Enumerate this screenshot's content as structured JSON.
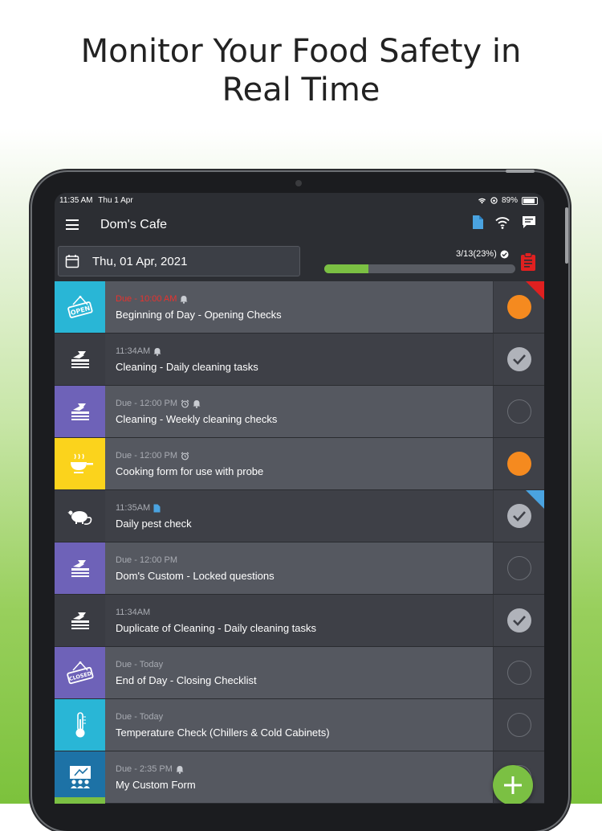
{
  "headline": {
    "line1": "Monitor Your Food Safety in",
    "line2": "Real Time"
  },
  "status_bar": {
    "time": "11:35 AM",
    "date": "Thu 1 Apr",
    "battery": "89%"
  },
  "app_bar": {
    "title": "Dom's Cafe"
  },
  "date_picker": {
    "value": "Thu, 01 Apr, 2021"
  },
  "progress": {
    "label": "3/13(23%)",
    "fraction": 0.23
  },
  "colors": {
    "teal": "#29b6d6",
    "purple": "#6e62b8",
    "yellow": "#fbd31c",
    "dark": "#3a3c43",
    "navy": "#1d72a6",
    "orange": "#f58a1f",
    "green": "#7bc043",
    "overdue_red": "#e8322e"
  },
  "forms": [
    {
      "meta": "Due - 10:00 AM",
      "meta_style": "overdue",
      "meta_icons": [
        "bell-icon"
      ],
      "name": "Beginning of Day - Opening Checks",
      "icon": "open-sign-icon",
      "icon_bg": "#29b6d6",
      "status": "in-progress",
      "corner": "red",
      "alt": false
    },
    {
      "meta": "11:34AM",
      "meta_style": "normal",
      "meta_icons": [
        "bell-icon"
      ],
      "name": "Cleaning - Daily cleaning tasks",
      "icon": "cleaning-icon",
      "icon_bg": "#3a3c43",
      "status": "complete",
      "corner": "",
      "alt": true
    },
    {
      "meta": "Due - 12:00 PM",
      "meta_style": "normal",
      "meta_icons": [
        "alarm-clock-icon",
        "bell-icon"
      ],
      "name": "Cleaning - Weekly cleaning checks",
      "icon": "cleaning-icon",
      "icon_bg": "#6e62b8",
      "status": "not-started",
      "corner": "",
      "alt": false
    },
    {
      "meta": "Due - 12:00 PM",
      "meta_style": "normal",
      "meta_icons": [
        "alarm-clock-icon"
      ],
      "name": "Cooking form for use with probe",
      "icon": "cooking-pan-icon",
      "icon_bg": "#fbd31c",
      "status": "in-progress",
      "corner": "",
      "alt": false
    },
    {
      "meta": "11:35AM",
      "meta_style": "normal",
      "meta_icons": [
        "document-icon"
      ],
      "name": "Daily pest check",
      "icon": "rat-icon",
      "icon_bg": "#3a3c43",
      "status": "complete",
      "corner": "blue",
      "alt": true
    },
    {
      "meta": "Due - 12:00 PM",
      "meta_style": "normal",
      "meta_icons": [],
      "name": "Dom's Custom - Locked questions",
      "icon": "cleaning-icon",
      "icon_bg": "#6e62b8",
      "status": "not-started",
      "corner": "",
      "alt": false
    },
    {
      "meta": "11:34AM",
      "meta_style": "normal",
      "meta_icons": [],
      "name": "Duplicate of Cleaning - Daily cleaning tasks",
      "icon": "cleaning-icon",
      "icon_bg": "#3a3c43",
      "status": "complete",
      "corner": "",
      "alt": true
    },
    {
      "meta": "Due - Today",
      "meta_style": "normal",
      "meta_icons": [],
      "name": "End of Day - Closing Checklist",
      "icon": "closed-sign-icon",
      "icon_bg": "#6e62b8",
      "status": "not-started",
      "corner": "",
      "alt": false
    },
    {
      "meta": "Due - Today",
      "meta_style": "normal",
      "meta_icons": [],
      "name": "Temperature Check (Chillers & Cold Cabinets)",
      "icon": "thermometer-icon",
      "icon_bg": "#29b6d6",
      "status": "not-started",
      "corner": "",
      "alt": false
    },
    {
      "meta": "Due - 2:35 PM",
      "meta_style": "normal",
      "meta_icons": [
        "bell-icon"
      ],
      "name": "My Custom Form",
      "icon": "training-icon",
      "icon_bg": "#1d72a6",
      "status": "not-started",
      "corner": "",
      "alt": false
    }
  ]
}
